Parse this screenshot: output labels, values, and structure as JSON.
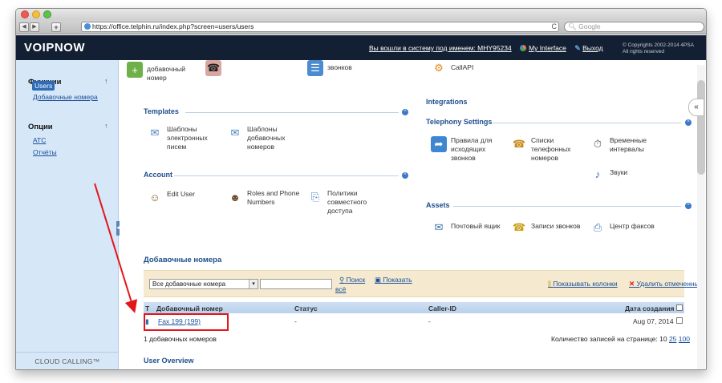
{
  "browser": {
    "url": "https://office.telphin.ru/index.php?screen=users/users",
    "search_placeholder": "Google",
    "reload": "C"
  },
  "header": {
    "logo": "VOIPNOW",
    "login_text": "Вы вошли в систему под именем: MHY95234",
    "my_interface": "My Interface",
    "logout": "Выход",
    "copyright_line1": "© Copyrights 2002-2014 4PSA",
    "copyright_line2": "All rights reserved"
  },
  "sidebar": {
    "functions_title": "Функции",
    "functions_items": [
      "Users",
      "Добавочные номера"
    ],
    "options_title": "Опции",
    "options_items": [
      "АТС",
      "Отчёты"
    ],
    "footer": "CLOUD CALLING™"
  },
  "top_partial": {
    "col1": "добавочный номер",
    "col2": "",
    "col3": "звонков",
    "col4": "CallAPI"
  },
  "integrations": {
    "title": "Integrations"
  },
  "templates": {
    "title": "Templates",
    "items": [
      "Шаблоны электронных писем",
      "Шаблоны добавочных номеров"
    ]
  },
  "telephony": {
    "title": "Telephony Settings",
    "items": [
      "Правила для исходящих звонков",
      "Списки телефонных номеров",
      "Временные интервалы",
      "Звуки"
    ]
  },
  "account": {
    "title": "Account",
    "items": [
      "Edit User",
      "Roles and Phone Numbers",
      "Политики совместного доступа"
    ]
  },
  "assets": {
    "title": "Assets",
    "items": [
      "Почтовый ящик",
      "Записи звонков",
      "Центр факсов"
    ]
  },
  "extensions": {
    "title": "Добавочные номера",
    "filter_value": "Все добавочные номера",
    "search_label": "Поиск",
    "show_all_label": "Показать",
    "show_all_label2": "всё",
    "show_columns": "Показывать колонки",
    "delete_selected": "Удалить отмеченные",
    "columns": [
      "Т",
      "Добавочный номер",
      "Статус",
      "Caller-ID",
      "Дата создания"
    ],
    "rows": [
      {
        "number": "Fax 199 (199)",
        "status": "-",
        "caller_id": "-",
        "created": "Aug 07, 2014"
      }
    ],
    "count_text": "1 добавочных номеров",
    "per_page_text": "Количество записей на странице: 10",
    "per_page_opts": [
      "25",
      "100"
    ]
  },
  "user_overview": {
    "title": "User Overview"
  },
  "colors": {
    "header_bg": "#132033",
    "sidebar_bg": "#d6e7f7",
    "accent": "#1e4e8c",
    "highlight": "#e3151a"
  }
}
